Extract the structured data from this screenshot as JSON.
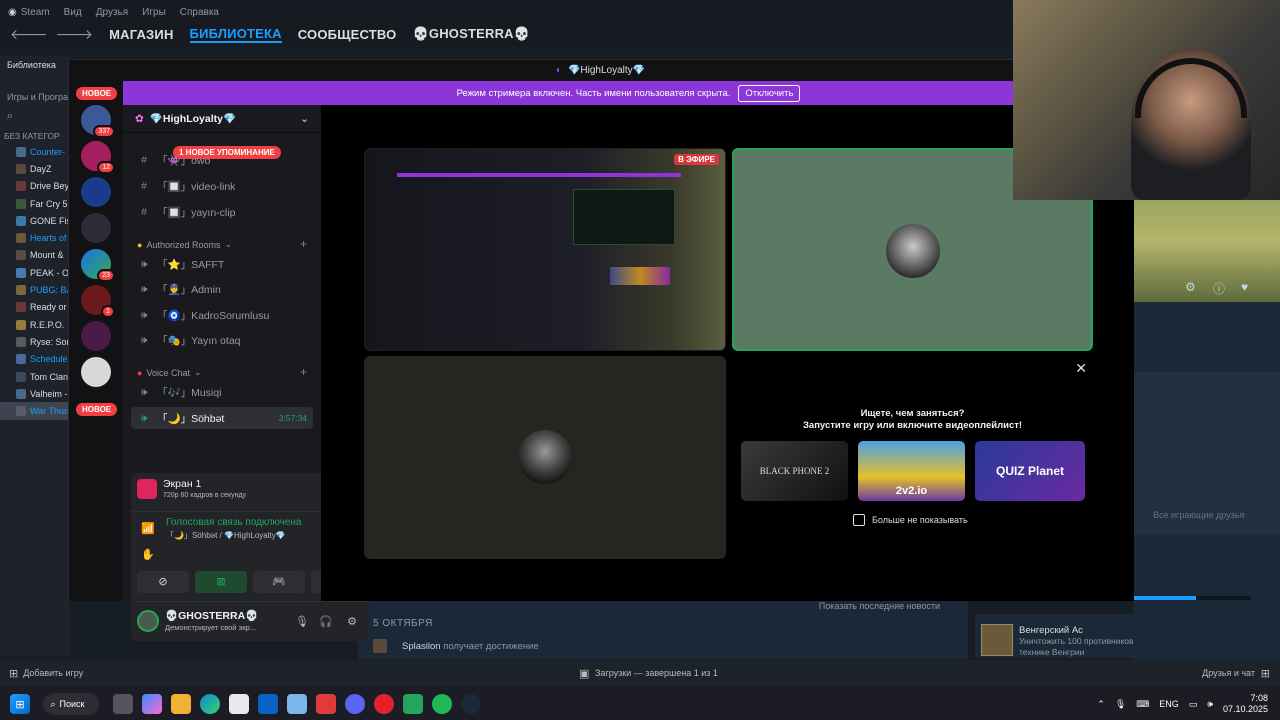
{
  "steam": {
    "menu": [
      "Steam",
      "Вид",
      "Друзья",
      "Игры",
      "Справка"
    ],
    "nav": [
      "МАГАЗИН",
      "БИБЛИОТЕКА",
      "СООБЩЕСТВО",
      "💀GHOSTERRA💀"
    ],
    "library_label": "Библиотека",
    "filter_label": "Игры и Програм",
    "category": "БЕЗ КАТЕГОР",
    "games": [
      "Counter-",
      "DayZ",
      "Drive Bey",
      "Far Cry 5",
      "GONE Fis",
      "Hearts of",
      "Mount &",
      "PEAK - O",
      "PUBG: BA",
      "Ready or",
      "R.E.P.O.",
      "Ryse: Son",
      "Schedule",
      "Tom Clan",
      "Valheim -",
      "War Thun"
    ],
    "add_game": "Добавить игру",
    "downloads": "Загрузки — завершена 1 из 1",
    "friends_chat": "Друзья и чат",
    "date_header": "5 ОКТЯБРЯ",
    "activity_user": "Splasilon",
    "activity_text": "получает достижение",
    "show_news": "Показать последние новости",
    "all_playing": "Все играющие друзья",
    "achievement_title": "Венгерский Ас",
    "achievement_desc": "Уничтожить 100 противников (под управлением игрока) на технике Венгрии"
  },
  "discord": {
    "window_title": "💎HighLoyalty💎",
    "streamer_mode_text": "Режим стримера включен. Часть имени пользователя скрыта.",
    "disable_button": "Отключить",
    "new_pill": "НОВОЕ",
    "guild_badges": [
      "337",
      "12",
      "23",
      "1"
    ],
    "server_name": "💎HighLoyalty💎",
    "new_mention": "1 НОВОЕ УПОМИНАНИЕ",
    "channels_text": [
      {
        "name": "「👾」owo"
      },
      {
        "name": "「🔲」video-link"
      },
      {
        "name": "「🔲」yayın-clip"
      }
    ],
    "category_authorized": "Authorized Rooms",
    "channels_voice_auth": [
      {
        "name": "「⭐」SAFFT"
      },
      {
        "name": "「👮」Admin"
      },
      {
        "name": "「🧿」KadroSorumlusu"
      },
      {
        "name": "「🎭」Yayın otaq"
      }
    ],
    "category_voice": "Voice Chat",
    "channels_voice": [
      {
        "name": "「🎶」Musiqi"
      },
      {
        "name": "「🌙」Söhbət",
        "timer": "3:57:34"
      }
    ],
    "screen_share_title": "Экран 1",
    "screen_share_sub": "720p 60 кадров в секунду",
    "voice_connected": "Голосовая связь подключена",
    "voice_channel_path": "「🌙」Söhbət / 💎HighLoyalty💎",
    "user_name": "💀GHOSTERRA💀",
    "user_status": "Демонстрирует свой экр...",
    "live_badge": "В ЭФИРЕ",
    "activity_prompt_title": "Ищете, чем заняться?",
    "activity_prompt_sub": "Запустите игру или включите видеоплейлист!",
    "activity_cards": [
      "BLACK PHONE 2",
      "2v2.io",
      "QUIZ Planet"
    ],
    "dont_show_again": "Больше не показывать"
  },
  "taskbar": {
    "search": "Поиск",
    "lang": "ENG",
    "time": "7:08",
    "date": "07.10.2025"
  },
  "colors": {
    "discord_purple": "#8c35d9",
    "discord_red": "#f23f43",
    "steam_blue": "#1a9fff",
    "voice_green": "#23a55a"
  }
}
